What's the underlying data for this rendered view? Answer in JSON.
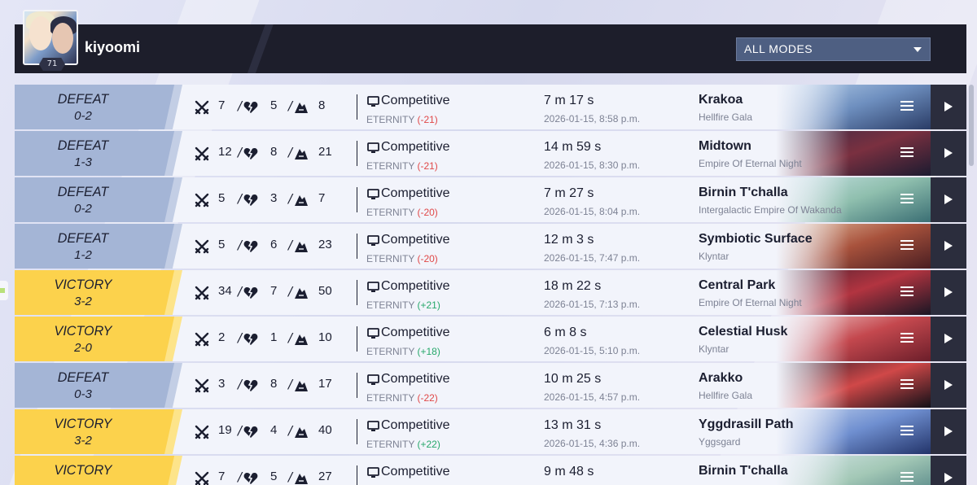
{
  "profile": {
    "username": "kiyoomi",
    "level": "71"
  },
  "filter": {
    "mode_selected": "ALL MODES"
  },
  "matches": [
    {
      "result": "DEFEAT",
      "score": "0-2",
      "type": "defeat",
      "kills": "7",
      "deaths": "5",
      "assists": "8",
      "mode": "Competitive",
      "rank": "ETERNITY",
      "delta": "(-21)",
      "delta_sign": "neg",
      "duration": "7 m 17 s",
      "date": "2026-01-15, 8:58 p.m.",
      "map": "Krakoa",
      "map_sub": "Hellfire Gala",
      "map_colors": [
        "#b9d2ec",
        "#6e8fbf",
        "#2a3c66"
      ]
    },
    {
      "result": "DEFEAT",
      "score": "1-3",
      "type": "defeat",
      "kills": "12",
      "deaths": "8",
      "assists": "21",
      "mode": "Competitive",
      "rank": "ETERNITY",
      "delta": "(-21)",
      "delta_sign": "neg",
      "duration": "14 m 59 s",
      "date": "2026-01-15, 8:30 p.m.",
      "map": "Midtown",
      "map_sub": "Empire Of Eternal Night",
      "map_colors": [
        "#3a2c46",
        "#7a3040",
        "#1c1b30"
      ]
    },
    {
      "result": "DEFEAT",
      "score": "0-2",
      "type": "defeat",
      "kills": "5",
      "deaths": "3",
      "assists": "7",
      "mode": "Competitive",
      "rank": "ETERNITY",
      "delta": "(-20)",
      "delta_sign": "neg",
      "duration": "7 m 27 s",
      "date": "2026-01-15, 8:04 p.m.",
      "map": "Birnin T'challa",
      "map_sub": "Intergalactic Empire Of Wakanda",
      "map_colors": [
        "#c9e2e6",
        "#8fbfae",
        "#3b6f74"
      ]
    },
    {
      "result": "DEFEAT",
      "score": "1-2",
      "type": "defeat",
      "kills": "5",
      "deaths": "6",
      "assists": "23",
      "mode": "Competitive",
      "rank": "ETERNITY",
      "delta": "(-20)",
      "delta_sign": "neg",
      "duration": "12 m 3 s",
      "date": "2026-01-15, 7:47 p.m.",
      "map": "Symbiotic Surface",
      "map_sub": "Klyntar",
      "map_colors": [
        "#e6c3a6",
        "#a8523c",
        "#4a1e22"
      ]
    },
    {
      "result": "VICTORY",
      "score": "3-2",
      "type": "victory",
      "kills": "34",
      "deaths": "7",
      "assists": "50",
      "mode": "Competitive",
      "rank": "ETERNITY",
      "delta": "(+21)",
      "delta_sign": "pos",
      "duration": "18 m 22 s",
      "date": "2026-01-15, 7:13 p.m.",
      "map": "Central Park",
      "map_sub": "Empire Of Eternal Night",
      "map_colors": [
        "#4a2130",
        "#b23440",
        "#1a1624"
      ]
    },
    {
      "result": "VICTORY",
      "score": "2-0",
      "type": "victory",
      "kills": "2",
      "deaths": "1",
      "assists": "10",
      "mode": "Competitive",
      "rank": "ETERNITY",
      "delta": "(+18)",
      "delta_sign": "pos",
      "duration": "6 m 8 s",
      "date": "2026-01-15, 5:10 p.m.",
      "map": "Celestial Husk",
      "map_sub": "Klyntar",
      "map_colors": [
        "#f3d3d3",
        "#c4484e",
        "#6c1e2a"
      ]
    },
    {
      "result": "DEFEAT",
      "score": "0-3",
      "type": "defeat",
      "kills": "3",
      "deaths": "8",
      "assists": "17",
      "mode": "Competitive",
      "rank": "ETERNITY",
      "delta": "(-22)",
      "delta_sign": "neg",
      "duration": "10 m 25 s",
      "date": "2026-01-15, 4:57 p.m.",
      "map": "Arakko",
      "map_sub": "Hellfire Gala",
      "map_colors": [
        "#2a1c2a",
        "#d04848",
        "#121018"
      ]
    },
    {
      "result": "VICTORY",
      "score": "3-2",
      "type": "victory",
      "kills": "19",
      "deaths": "4",
      "assists": "40",
      "mode": "Competitive",
      "rank": "ETERNITY",
      "delta": "(+22)",
      "delta_sign": "pos",
      "duration": "13 m 31 s",
      "date": "2026-01-15, 4:36 p.m.",
      "map": "Yggdrasill Path",
      "map_sub": "Yggsgard",
      "map_colors": [
        "#c6d6f0",
        "#6f8fd0",
        "#23346a"
      ]
    },
    {
      "result": "VICTORY",
      "score": "",
      "type": "victory",
      "kills": "7",
      "deaths": "5",
      "assists": "27",
      "mode": "Competitive",
      "rank": "",
      "delta": "",
      "delta_sign": "neg",
      "duration": "9 m 48 s",
      "date": "",
      "map": "Birnin T'challa",
      "map_sub": "",
      "map_colors": [
        "#d6e6ea",
        "#a3c8b6",
        "#4d7f82"
      ]
    }
  ]
}
